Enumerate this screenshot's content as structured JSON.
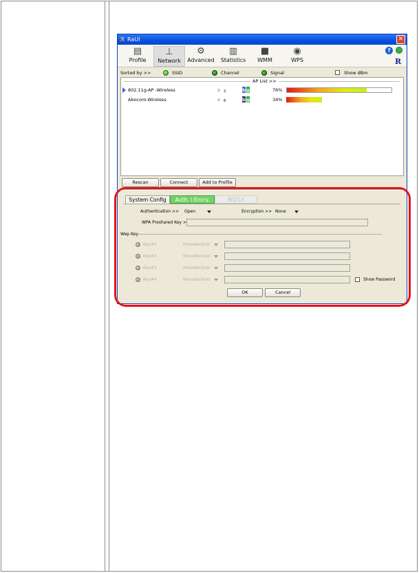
{
  "window": {
    "title": "RaUI",
    "close_glyph": "✕",
    "icon": "app-logo-icon"
  },
  "toolbar": {
    "items": [
      {
        "label": "Profile",
        "icon": "profile-icon",
        "active": false
      },
      {
        "label": "Network",
        "icon": "network-icon",
        "active": true
      },
      {
        "label": "Advanced",
        "icon": "advanced-gear-icon",
        "active": false
      },
      {
        "label": "Statistics",
        "icon": "statistics-icon",
        "active": false
      },
      {
        "label": "WMM",
        "icon": "wmm-icon",
        "active": false
      },
      {
        "label": "WPS",
        "icon": "wps-icon",
        "active": false
      }
    ],
    "help_glyph": "?",
    "brand_glyph": "R"
  },
  "sortbar": {
    "label": "Sorted by >>",
    "ssid": "SSID",
    "channel": "Channel",
    "signal": "Signal",
    "show_dbm": "Show dBm"
  },
  "ap_list": {
    "header": "AP List >>",
    "rows": [
      {
        "ssid": "802.11g-AP -Wireless",
        "channel": "2",
        "signal": "76%",
        "signal_value": 76,
        "selected": true
      },
      {
        "ssid": "Abocom-Wireless",
        "channel": "6",
        "signal": "34%",
        "signal_value": 34,
        "selected": false
      }
    ],
    "badge_b": "b",
    "badge_g": "g"
  },
  "actions": {
    "rescan": "Rescan",
    "connect": "Connect",
    "add_to_profile": "Add to Profile"
  },
  "tabs": {
    "system_config": "System Config",
    "auth_encry": "Auth. \\ Encry.",
    "ieee8021x": "8021X"
  },
  "auth": {
    "authentication_label": "Authentication >>",
    "authentication_value": "Open",
    "encryption_label": "Encryption >>",
    "encryption_value": "None",
    "wpa_key_label": "WPA Preshared Key >>",
    "wep_key_label": "Wep Key",
    "wep_keys": [
      {
        "label": "Key#1",
        "format": "Hexadecimal"
      },
      {
        "label": "Key#2",
        "format": "Hexadecimal"
      },
      {
        "label": "Key#3",
        "format": "Hexadecimal"
      },
      {
        "label": "Key#4",
        "format": "Hexadecimal"
      }
    ],
    "show_password": "Show Password",
    "ok": "OK",
    "cancel": "Cancel"
  },
  "colors": {
    "highlight": "#e5131b",
    "active_tab": "#72d267",
    "titlebar": "#0a4ee0"
  }
}
